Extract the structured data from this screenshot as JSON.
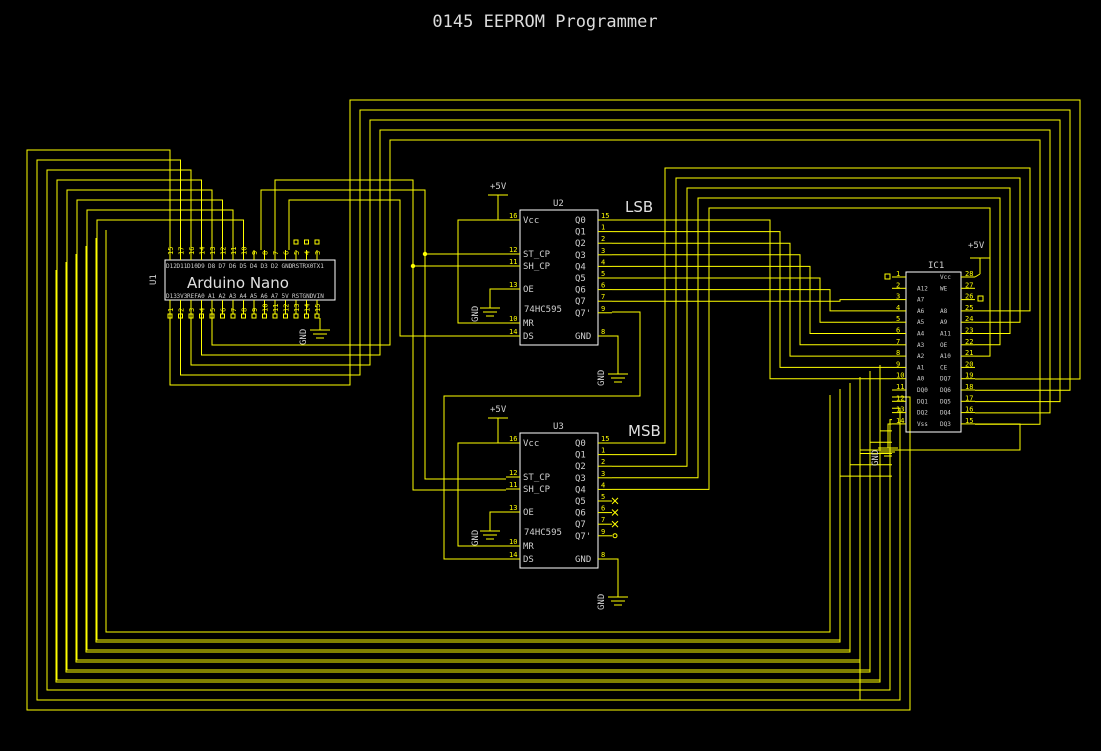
{
  "title": "0145 EEPROM Programmer",
  "colors": {
    "background": "#000000",
    "wire": "#ffff00",
    "body": "#ffffff",
    "text": "#d9d9d9"
  },
  "nano": {
    "ref": "U1",
    "name": "Arduino Nano",
    "top_pins": [
      "D12",
      "D11",
      "D10",
      "D9",
      "D8",
      "D7",
      "D6",
      "D5",
      "D4",
      "D3",
      "D2",
      "GND",
      "RST",
      "RX0",
      "TX1"
    ],
    "top_nums": [
      "15",
      "17",
      "16",
      "14",
      "13",
      "12",
      "11",
      "10",
      "9",
      "8",
      "7",
      "6",
      "5",
      "4",
      "3"
    ],
    "top_nums_right": [
      "29",
      "28",
      "1"
    ],
    "bottom_pins": [
      "D13",
      "3V3",
      "REF",
      "A0",
      "A1",
      "A2",
      "A3",
      "A4",
      "A5",
      "A6",
      "A7",
      "5V",
      "RST",
      "GND",
      "VIN"
    ],
    "bottom_nums": [
      "1",
      "2",
      "3",
      "4",
      "5",
      "6",
      "7",
      "8",
      "9",
      "10",
      "11",
      "12",
      "13",
      "14",
      "15"
    ],
    "gnd": "GND"
  },
  "u2": {
    "ref": "U2",
    "part": "74HC595",
    "tag": "LSB",
    "supply": "+5V",
    "gnd": "GND",
    "left_pins": [
      "Vcc",
      "ST_CP",
      "SH_CP",
      "OE",
      "MR",
      "DS"
    ],
    "left_nums": [
      "16",
      "12",
      "11",
      "13",
      "10",
      "14"
    ],
    "right_pins": [
      "Q0",
      "Q1",
      "Q2",
      "Q3",
      "Q4",
      "Q5",
      "Q6",
      "Q7",
      "Q7'",
      "GND"
    ],
    "right_nums": [
      "15",
      "1",
      "2",
      "3",
      "4",
      "5",
      "6",
      "7",
      "9",
      "8"
    ]
  },
  "u3": {
    "ref": "U3",
    "part": "74HC595",
    "tag": "MSB",
    "supply": "+5V",
    "gnd": "GND",
    "left_pins": [
      "Vcc",
      "ST_CP",
      "SH_CP",
      "OE",
      "MR",
      "DS"
    ],
    "left_nums": [
      "16",
      "12",
      "11",
      "13",
      "10",
      "14"
    ],
    "right_pins": [
      "Q0",
      "Q1",
      "Q2",
      "Q3",
      "Q4",
      "Q5",
      "Q6",
      "Q7",
      "Q7'",
      "GND"
    ],
    "right_nums": [
      "15",
      "1",
      "2",
      "3",
      "4",
      "5",
      "6",
      "7",
      "9",
      "8"
    ]
  },
  "ic1": {
    "ref": "IC1",
    "supply": "+5V",
    "gnd": "GND",
    "left_pins": [
      "",
      "A12",
      "A7",
      "A6",
      "A5",
      "A4",
      "A3",
      "A2",
      "A1",
      "A0",
      "DQ0",
      "DQ1",
      "DQ2",
      "Vss"
    ],
    "left_nums": [
      "1",
      "2",
      "3",
      "4",
      "5",
      "6",
      "7",
      "8",
      "9",
      "10",
      "11",
      "12",
      "13",
      "14"
    ],
    "right_pins": [
      "Vcc",
      "WE",
      "",
      "A8",
      "A9",
      "A11",
      "OE",
      "A10",
      "CE",
      "DQ7",
      "DQ6",
      "DQ5",
      "DQ4",
      "DQ3"
    ],
    "right_nums": [
      "28",
      "27",
      "26",
      "25",
      "24",
      "23",
      "22",
      "21",
      "20",
      "19",
      "18",
      "17",
      "16",
      "15"
    ]
  }
}
